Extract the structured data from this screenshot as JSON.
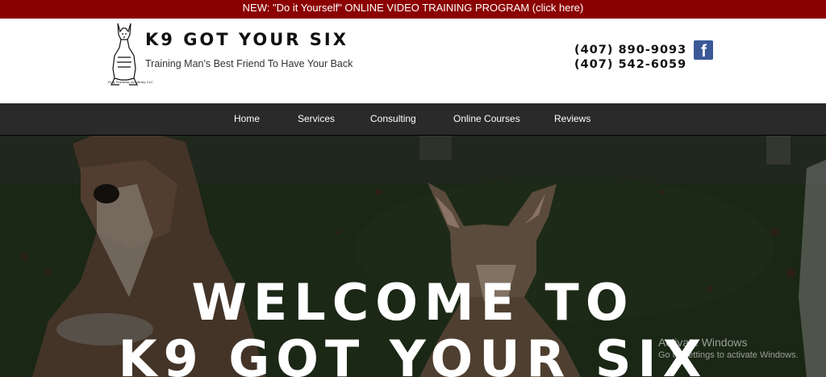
{
  "promo": {
    "text": "NEW:  \"Do it Yourself\" ONLINE VIDEO TRAINING PROGRAM (click here)"
  },
  "header": {
    "brand_title": "K9 GOT YOUR SIX",
    "tagline": "Training Man's Best Friend To Have Your Back",
    "logo_caption": "Dog Training Academy LLC",
    "phones": [
      "(407) 890-9093",
      "(407) 542-6059"
    ],
    "social_icon": "facebook-icon"
  },
  "nav": {
    "items": [
      {
        "label": "Home"
      },
      {
        "label": "Services"
      },
      {
        "label": "Consulting"
      },
      {
        "label": "Online Courses"
      },
      {
        "label": "Reviews"
      }
    ]
  },
  "hero": {
    "line1": "WELCOME TO",
    "line2": "K9 GOT YOUR SIX"
  },
  "watermark": {
    "line1": "Activate Windows",
    "line2": "Go to Settings to activate Windows."
  },
  "colors": {
    "promo_bg": "#8b0000",
    "nav_bg": "#2a2a2a",
    "facebook": "#3b5998"
  }
}
